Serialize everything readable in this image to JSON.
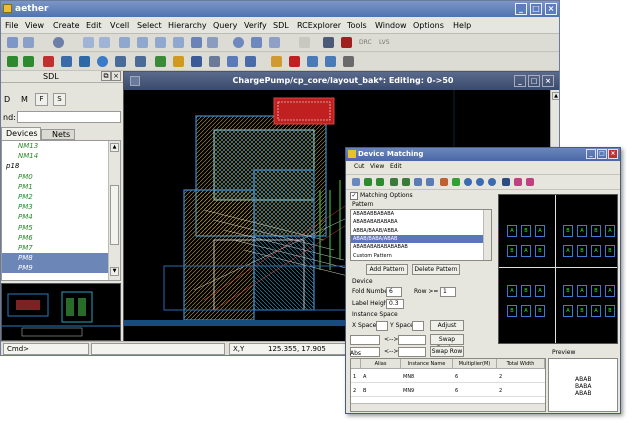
{
  "app": {
    "title": "aether"
  },
  "menu": [
    "File",
    "View",
    "Create",
    "Edit",
    "Vcell",
    "Select",
    "Hierarchy",
    "Query",
    "Verify",
    "SDL",
    "RCExplorer",
    "Tools",
    "Window",
    "Options",
    "Help"
  ],
  "toolbar": {
    "drc_label": "DRC",
    "lvs_label": "LVS"
  },
  "sdl_panel": {
    "title": "SDL",
    "mode_labels": [
      "D",
      "M",
      "F",
      "S"
    ],
    "find_label": "nd:",
    "tabs": [
      "Devices",
      "Nets"
    ],
    "tree": [
      "NM13",
      "NM14",
      "p18",
      "PM0",
      "PM1",
      "PM2",
      "PM3",
      "PM4",
      "PM5",
      "PM6",
      "PM7",
      "PM8",
      "PM9"
    ],
    "selected": [
      "PM8",
      "PM9"
    ]
  },
  "canvas": {
    "title": "ChargePump/cp_core/layout_bak*: Editing: 0->50"
  },
  "status": {
    "cmd_label": "Cmd>",
    "xy_label": "X,Y",
    "xy_value": "125.355, 17.905"
  },
  "dialog": {
    "title": "Device Matching",
    "menu": [
      "Cut",
      "View",
      "Edit"
    ],
    "matching_options_label": "Matching Options",
    "pattern_label": "Pattern",
    "patterns": [
      "ABABABBABABA",
      "ABABABABABABA",
      "ABBA/BAAB/ABBA",
      "ABAB/BABA/ABAB",
      "ABABABABABABABAB",
      "Custom Pattern"
    ],
    "selected_pattern_index": 3,
    "add_pattern": "Add Pattern",
    "delete_pattern": "Delete Pattern",
    "device_label": "Device",
    "fold_number_label": "Fold Number",
    "fold_number": "6",
    "row_label": "Row >=",
    "row_value": "1",
    "label_height_label": "Label Height",
    "label_height": "0.3",
    "instance_space_label": "Instance Space",
    "xspace_label": "X Space",
    "yspace_label": "Y Space",
    "adjust": "Adjust",
    "swap_device": "Swap Device",
    "swap_row": "Swap Row",
    "arrow": "<-->",
    "abs_label": "Abs",
    "preview_label": "Preview",
    "table_headers": [
      "",
      "Alias",
      "Instance Name",
      "Multiplier(M)",
      "Total Width"
    ],
    "table_rows": [
      [
        "1",
        "A",
        "MN8",
        "6",
        "2"
      ],
      [
        "2",
        "B",
        "MN9",
        "6",
        "2"
      ]
    ],
    "preview_text": [
      "ABAB",
      "BABA",
      "ABAB"
    ],
    "matrix_labels": [
      "A",
      "B",
      "A",
      "B",
      "A",
      "B",
      "A",
      "B"
    ]
  }
}
